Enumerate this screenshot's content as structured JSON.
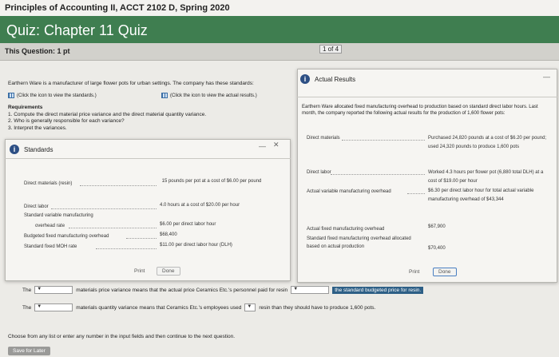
{
  "course_title": "Principles of Accounting II, ACCT 2102 D, Spring 2020",
  "quiz_title": "Quiz: Chapter 11 Quiz",
  "question_label": "This Question: 1 pt",
  "position": "1 of 4",
  "question": {
    "text": "Earthern Ware is a manufacturer of large flower pots for urban settings. The company has these standards:",
    "standards_link": "(Click the icon to view the standards.)",
    "actual_link": "(Click the icon to view the actual results.)",
    "requirements_title": "Requirements",
    "requirements": [
      "1. Compute the direct material price variance and the direct material quantity variance.",
      "2. Who is generally responsible for each variance?",
      "3. Interpret the variances."
    ]
  },
  "standards_panel": {
    "title": "Standards",
    "rows": [
      {
        "label": "Direct materials (resin)",
        "value": "15 pounds per pot at a cost of $6.00 per pound"
      },
      {
        "label": "Direct labor",
        "value": "4.0 hours at a cost of $20.00 per hour"
      },
      {
        "label": "Standard variable manufacturing",
        "value": ""
      },
      {
        "label": "overhead rate",
        "value": "$6.00 per direct labor hour"
      },
      {
        "label": "Budgeted fixed manufacturing overhead",
        "value": "$68,400"
      },
      {
        "label": "Standard fixed MOH rate",
        "value": "$11.00 per direct labor hour (DLH)"
      }
    ],
    "print_label": "Print",
    "done_label": "Done"
  },
  "actual_panel": {
    "title": "Actual Results",
    "intro": "Earthern Ware allocated fixed manufacturing overhead to production based on standard direct labor hours. Last month, the company reported the following actual results for the production of 1,600 flower pots:",
    "rows": [
      {
        "label": "Direct materials",
        "value": "Purchased 24,820 pounds at a cost of $6.20 per pound; used 24,320 pounds to produce 1,600 pots"
      },
      {
        "label": "Direct labor",
        "value": "Worked 4.3 hours per flower pot (6,880 total DLH) at a cost of $19.00 per hour"
      },
      {
        "label": "Actual variable manufacturing overhead",
        "value": "$6.30 per direct labor hour for total actual variable manufacturing overhead of $43,344"
      },
      {
        "label": "Actual fixed manufacturing overhead",
        "value": "$67,900"
      },
      {
        "label": "Standard fixed manufacturing overhead allocated based on actual production",
        "value": "$70,400"
      }
    ],
    "print_label": "Print",
    "done_label": "Done"
  },
  "answers": {
    "row1_lead": "The",
    "row1_text": "materials price variance means that the actual price Ceramics Etc.'s personnel paid for resin",
    "row1_highlight": "the standard budgeted price for resin.",
    "row2_lead": "The",
    "row2_text": "materials quantity variance means that Ceramics Etc.'s employees used",
    "row2_tail": "resin than they should have to produce 1,600 pots."
  },
  "footer_note": "Choose from any list or enter any number in the input fields and then continue to the next question.",
  "save_label": "Save for Later"
}
